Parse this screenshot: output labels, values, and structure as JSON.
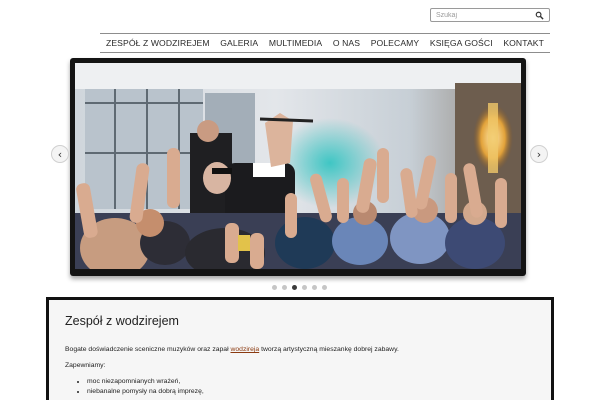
{
  "search": {
    "placeholder": "Szukaj",
    "icon": "magnifier-icon"
  },
  "nav": {
    "items": [
      {
        "label": "ZESPÓŁ Z WODZIREJEM"
      },
      {
        "label": "GALERIA"
      },
      {
        "label": "MULTIMEDIA"
      },
      {
        "label": "O NAS"
      },
      {
        "label": "POLECAMY"
      },
      {
        "label": "KSIĘGA GOŚCI"
      },
      {
        "label": "KONTAKT"
      }
    ]
  },
  "slider": {
    "prev_icon": "chevron-left-icon",
    "next_icon": "chevron-right-icon",
    "prev_glyph": "‹",
    "next_glyph": "›",
    "dot_count": 6,
    "active_dot": 3
  },
  "content": {
    "title": "Zespół z wodzirejem",
    "intro_before": "Bogate doświadczenie sceniczne muzyków oraz zapał ",
    "intro_link": "wodzireja",
    "intro_after": " tworzą artystyczną mieszankę dobrej zabawy.",
    "subheading": "Zapewniamy:",
    "bullets": [
      "moc niezapomnianych wrażeń,",
      "niebanalne pomysły na dobrą imprezę,"
    ]
  },
  "colors": {
    "link": "#8b3a10",
    "frame": "#141414",
    "content_bg": "#f6f6f6"
  }
}
